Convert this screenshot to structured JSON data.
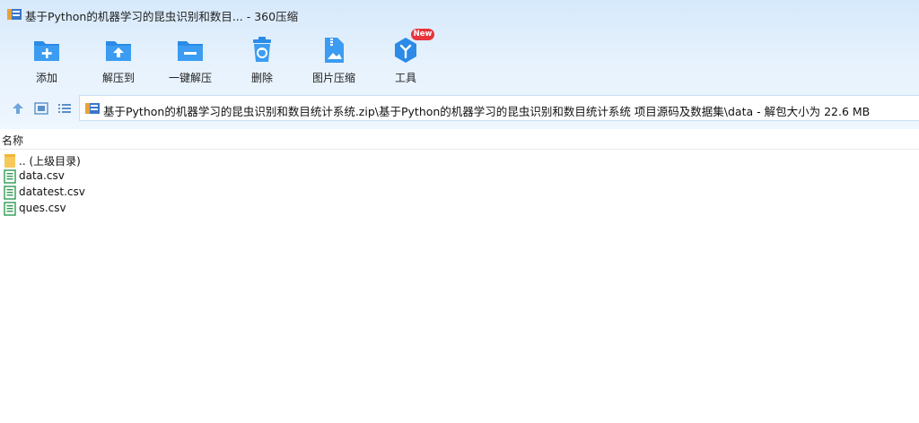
{
  "window": {
    "title": "基于Python的机器学习的昆虫识别和数目... - 360压缩"
  },
  "toolbar": {
    "items": [
      {
        "label": "添加",
        "icon": "add-folder-icon"
      },
      {
        "label": "解压到",
        "icon": "extract-to-icon"
      },
      {
        "label": "一键解压",
        "icon": "one-click-extract-icon"
      },
      {
        "label": "删除",
        "icon": "trash-icon"
      },
      {
        "label": "图片压缩",
        "icon": "image-compress-icon"
      },
      {
        "label": "工具",
        "icon": "tools-icon",
        "badge": "New"
      }
    ]
  },
  "address": {
    "path": "基于Python的机器学习的昆虫识别和数目统计系统.zip\\基于Python的机器学习的昆虫识别和数目统计系统 项目源码及数据集\\data - 解包大小为 22.6 MB"
  },
  "list": {
    "column_name": "名称",
    "rows": [
      {
        "name": ".. (上级目录)",
        "type": "folder"
      },
      {
        "name": "data.csv",
        "type": "csv"
      },
      {
        "name": "datatest.csv",
        "type": "csv"
      },
      {
        "name": "ques.csv",
        "type": "csv"
      }
    ]
  },
  "colors": {
    "accent": "#2b8be6",
    "badge": "#e8343b",
    "folder": "#f6c95a",
    "csv": "#2e9b52"
  }
}
